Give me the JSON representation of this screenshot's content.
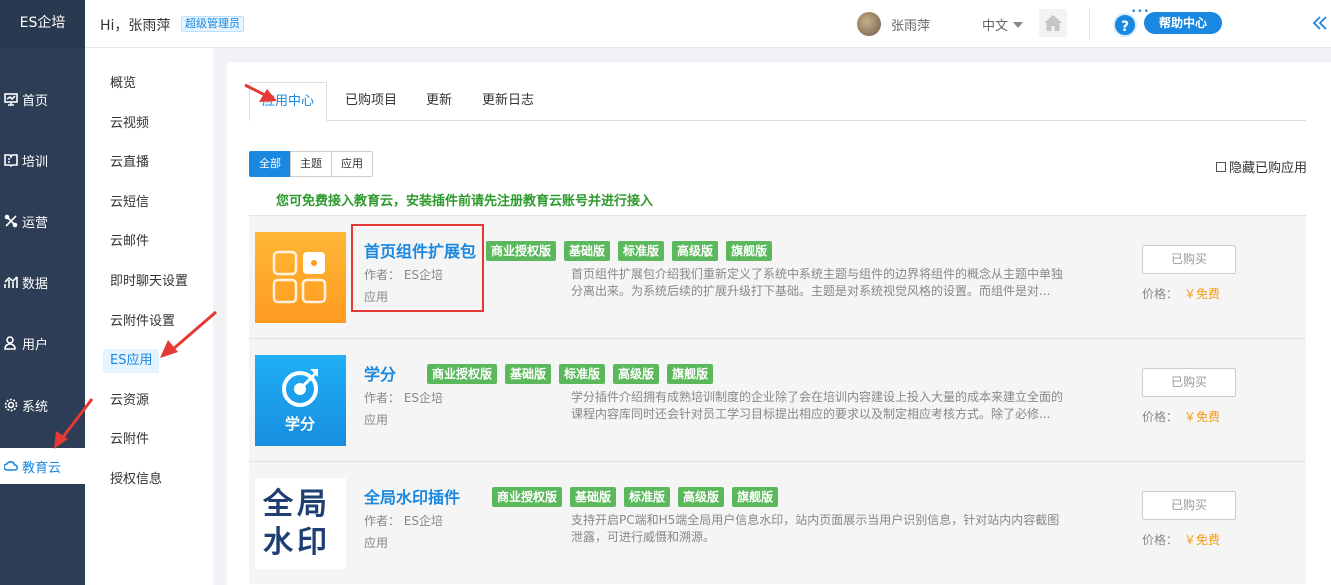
{
  "brand": "ES企培",
  "header": {
    "greeting": "Hi，张雨萍",
    "role": "超级管理员",
    "username": "张雨萍",
    "language": "中文",
    "help_label": "帮助中心",
    "help_mark": "?",
    "help_dots": "•••"
  },
  "left_nav": [
    {
      "label": "首页",
      "icon": "monitor-icon"
    },
    {
      "label": "培训",
      "icon": "book-icon"
    },
    {
      "label": "运营",
      "icon": "cross-tools-icon"
    },
    {
      "label": "数据",
      "icon": "chart-icon"
    },
    {
      "label": "用户",
      "icon": "user-icon"
    },
    {
      "label": "系统",
      "icon": "gear-icon"
    },
    {
      "label": "教育云",
      "icon": "cloud-icon",
      "active": true
    }
  ],
  "sub_nav": [
    "概览",
    "云视频",
    "云直播",
    "云短信",
    "云邮件",
    "即时聊天设置",
    "云附件设置",
    "ES应用",
    "云资源",
    "云附件",
    "授权信息"
  ],
  "tabs": [
    "应用中心",
    "已购项目",
    "更新",
    "更新日志"
  ],
  "filters": [
    "全部",
    "主题",
    "应用"
  ],
  "hide_bought_label": "隐藏已购应用",
  "notice": "您可免费接入教育云，安装插件前请先注册教育云账号并进行接入",
  "apps": [
    {
      "title": "首页组件扩展包",
      "badges": [
        "商业授权版",
        "基础版",
        "标准版",
        "高级版",
        "旗舰版"
      ],
      "author": "作者：  ES企培",
      "type": "应用",
      "description": "首页组件扩展包介绍我们重新定义了系统中系统主题与组件的边界将组件的概念从主题中单独分离出来。为系统后续的扩展升级打下基础。主题是对系统视觉风格的设置。而组件是对...",
      "button": "已购买",
      "price_label": "价格：",
      "price_value": "￥免费",
      "thumb_text": ""
    },
    {
      "title": "学分",
      "badges": [
        "商业授权版",
        "基础版",
        "标准版",
        "高级版",
        "旗舰版"
      ],
      "author": "作者：  ES企培",
      "type": "应用",
      "description": "学分插件介绍拥有成熟培训制度的企业除了会在培训内容建设上投入大量的成本来建立全面的课程内容库同时还会针对员工学习目标提出相应的要求以及制定相应考核方式。除了必修...",
      "button": "已购买",
      "price_label": "价格：",
      "price_value": "￥免费",
      "thumb_text": "学分"
    },
    {
      "title": "全局水印插件",
      "badges": [
        "商业授权版",
        "基础版",
        "标准版",
        "高级版",
        "旗舰版"
      ],
      "author": "作者：  ES企培",
      "type": "应用",
      "description": "支持开启PC端和H5端全局用户信息水印，站内页面展示当用户识别信息，针对站内内容截图泄露，可进行威慑和溯源。",
      "button": "已购买",
      "price_label": "价格：",
      "price_value": "￥免费",
      "thumb_text": "全局水印"
    }
  ],
  "colors": {
    "accent": "#1a88e0",
    "sidebar": "#2c3d55",
    "badge": "#5cb85c",
    "price": "#f39c12",
    "notice": "#2e9a2e",
    "highlight": "#e53935"
  }
}
